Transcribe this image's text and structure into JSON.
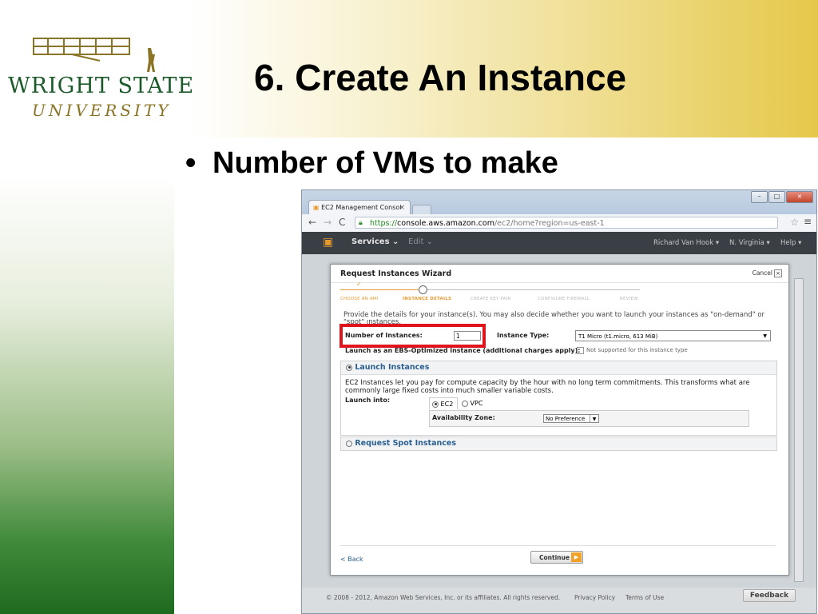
{
  "slide": {
    "title": "6. Create An Instance",
    "bullet": "Number of VMs to make",
    "logo": {
      "name": "WRIGHT STATE",
      "sub": "UNIVERSITY"
    }
  },
  "browser": {
    "tab_title": "EC2 Management Consol",
    "url": {
      "scheme": "https://",
      "host": "console.aws.amazon.com",
      "path": "/ec2/home?region=us-east-1"
    }
  },
  "aws_nav": {
    "services": "Services ⌄",
    "edit": "Edit ⌄",
    "user": "Richard Van Hook ▾",
    "region": "N. Virginia ▾",
    "help": "Help ▾"
  },
  "wizard": {
    "title": "Request Instances Wizard",
    "cancel": "Cancel",
    "steps": [
      "CHOOSE AN AMI",
      "INSTANCE DETAILS",
      "CREATE KEY PAIR",
      "CONFIGURE FIREWALL",
      "REVIEW"
    ],
    "intro": "Provide the details for your instance(s). You may also decide whether you want to launch your instances as \"on-demand\" or",
    "intro_cont": "\"spot\" instances.",
    "num_label": "Number of Instances:",
    "num_value": "1",
    "type_label": "Instance Type:",
    "type_value": "T1 Micro (t1.micro, 613 MiB)",
    "ebs_label": "Launch as an EBS-Optimized instance (additional charges apply):",
    "ebs_note": "Not supported for this instance type",
    "launch": {
      "title": "Launch Instances",
      "desc": "EC2 Instances let you pay for compute capacity by the hour with no long term commitments. This transforms what are commonly large fixed costs into much smaller variable costs.",
      "into_label": "Launch into:",
      "ec2": "EC2",
      "vpc": "VPC",
      "az_label": "Availability Zone:",
      "az_value": "No Preference"
    },
    "spot": {
      "title": "Request Spot Instances"
    },
    "back": "< Back",
    "continue": "Continue"
  },
  "footer": {
    "copyright": "© 2008 - 2012, Amazon Web Services, Inc. or its affiliates. All rights reserved.",
    "privacy": "Privacy Policy",
    "terms": "Terms of Use",
    "feedback": "Feedback"
  },
  "colors": {
    "wsu_green": "#1d5a2b",
    "wsu_gold": "#8a7426",
    "highlight_red": "#e0141c",
    "aws_orange": "#e49a32"
  }
}
